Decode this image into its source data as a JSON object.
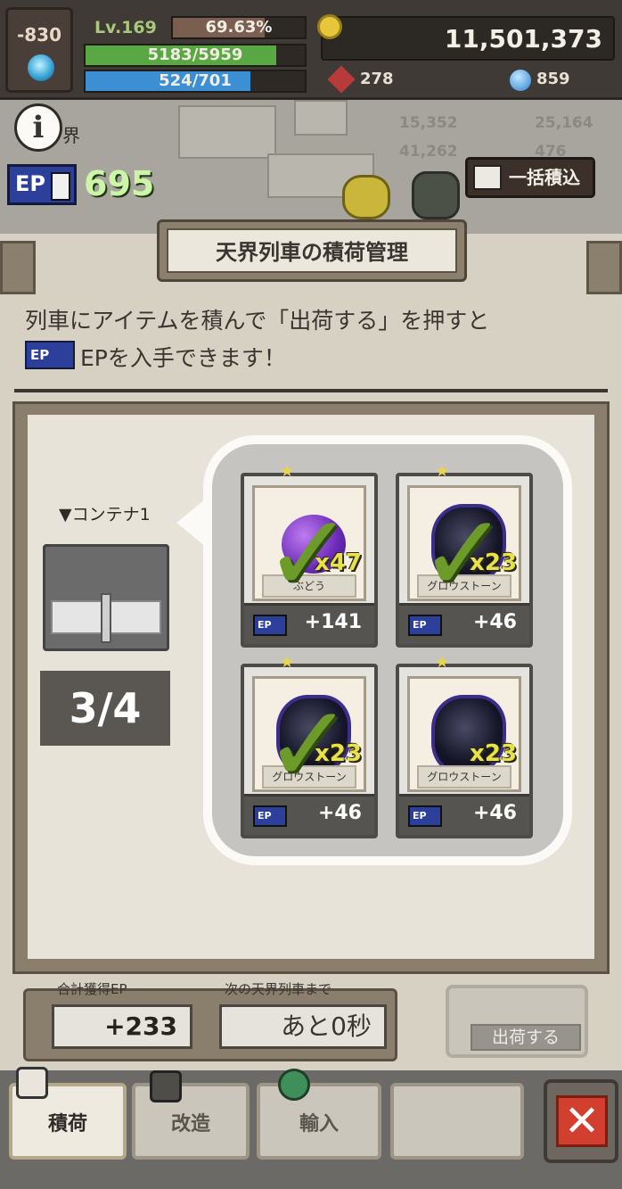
{
  "hud": {
    "level_delta": "-830",
    "level": "Lv.169",
    "xp_percent_text": "69.63%",
    "xp_fraction": 0.6963,
    "hp_text": "5183/5959",
    "hp_fraction": 0.87,
    "mp_text": "524/701",
    "mp_fraction": 0.75,
    "gold": "11,501,373",
    "ruby": "278",
    "gem": "859"
  },
  "map": {
    "area_name": "界",
    "res1": "15,352",
    "res2": "25,164",
    "res3": "41,262",
    "res4": "476"
  },
  "ep": {
    "tag": "EP",
    "value": "695"
  },
  "bulk_button": "一括積込",
  "modal": {
    "title": "天界列車の積荷管理",
    "desc_line1": "列車にアイテムを積んで「出荷する」を押すと",
    "desc_line2": "EPを入手できます！",
    "container_label": "▼コンテナ1",
    "count": "3/4",
    "slots": [
      {
        "name": "ぶどう",
        "qty": "x47",
        "ep": "+141",
        "checked": true
      },
      {
        "name": "グロウストーン",
        "qty": "x23",
        "ep": "+46",
        "checked": true
      },
      {
        "name": "グロウストーン",
        "qty": "x23",
        "ep": "+46",
        "checked": true
      },
      {
        "name": "グロウストーン",
        "qty": "x23",
        "ep": "+46",
        "checked": false
      }
    ],
    "total_label": "合計獲得EP",
    "total_value": "+233",
    "next_label": "次の天界列車まで",
    "next_value": "あと0秒",
    "ship_button": "出荷する"
  },
  "tabs": {
    "load": "積荷",
    "modify": "改造",
    "import": "輸入"
  },
  "close_icon": "close-icon",
  "colors": {
    "hp": "#5aa843",
    "mp": "#3b8fd2",
    "ep_green": "#cdf5a8",
    "check": "#6d9b2a"
  }
}
